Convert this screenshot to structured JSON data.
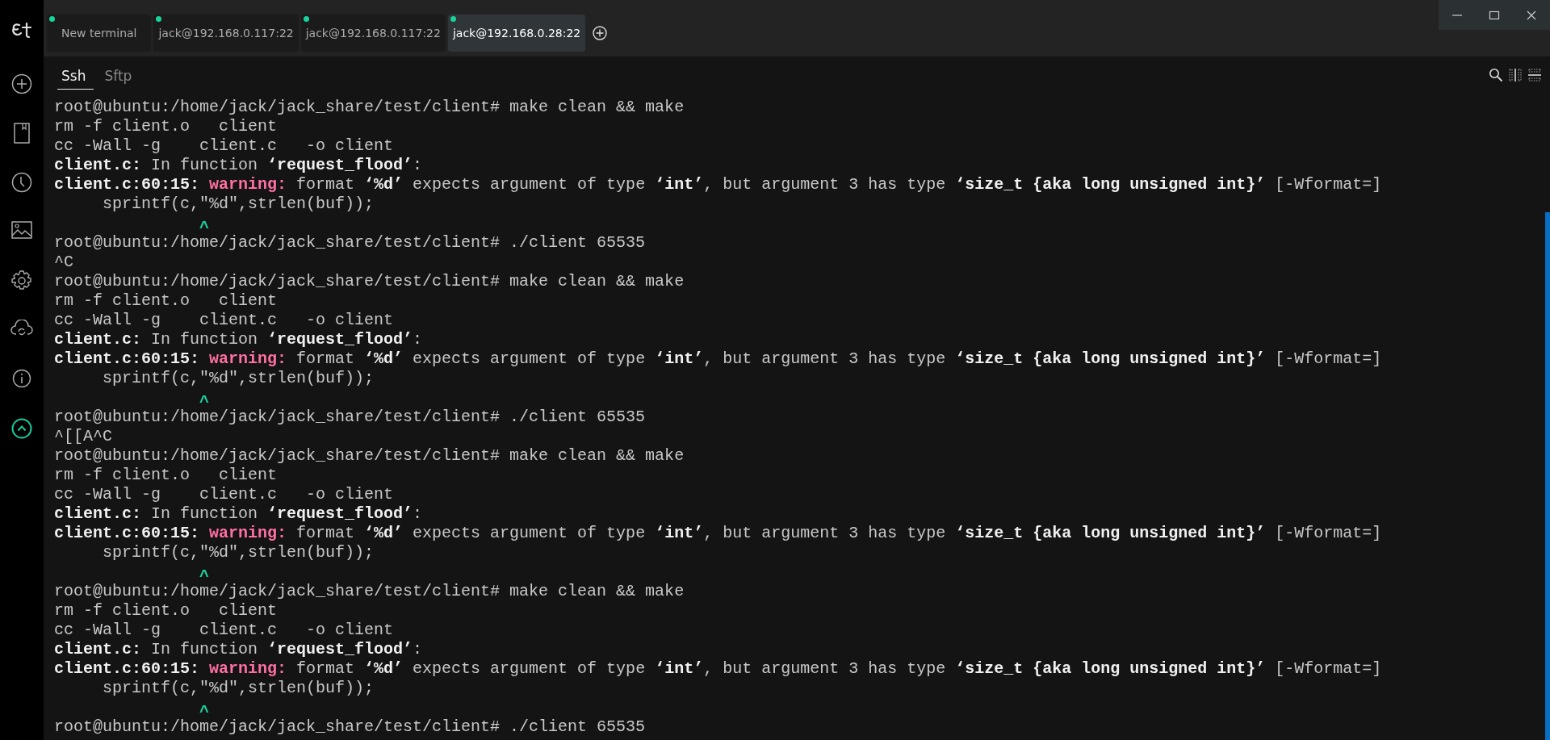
{
  "tabs": [
    {
      "label": "New terminal",
      "online": true,
      "selected": false
    },
    {
      "label": "jack@192.168.0.117:22",
      "online": true,
      "selected": false
    },
    {
      "label": "jack@192.168.0.117:22",
      "online": true,
      "selected": false
    },
    {
      "label": "jack@192.168.0.28:22",
      "online": true,
      "selected": true
    }
  ],
  "subtabs": [
    {
      "label": "Ssh",
      "selected": true
    },
    {
      "label": "Sftp",
      "selected": false
    }
  ],
  "terminal": {
    "lines": [
      [
        {
          "t": "root@ubuntu:/home/jack/jack_share/test/client# make clean && make",
          "kind": "plain"
        }
      ],
      [
        {
          "t": "rm -f client.o   client",
          "kind": "plain"
        }
      ],
      [
        {
          "t": "cc -Wall -g    client.c   -o client",
          "kind": "plain"
        }
      ],
      [
        {
          "t": "client.c:",
          "kind": "bold"
        },
        {
          "t": " In function ",
          "kind": "plain"
        },
        {
          "t": "‘request_flood’",
          "kind": "bold"
        },
        {
          "t": ":",
          "kind": "plain"
        }
      ],
      [
        {
          "t": "client.c:60:15: ",
          "kind": "bold"
        },
        {
          "t": "warning:",
          "kind": "warn"
        },
        {
          "t": " format ",
          "kind": "plain"
        },
        {
          "t": "‘%d’",
          "kind": "bold"
        },
        {
          "t": " expects argument of type ",
          "kind": "plain"
        },
        {
          "t": "‘int’",
          "kind": "bold"
        },
        {
          "t": ", but argument 3 has type ",
          "kind": "plain"
        },
        {
          "t": "‘size_t {aka long unsigned int}’",
          "kind": "bold"
        },
        {
          "t": " [-Wformat=]",
          "kind": "plain"
        }
      ],
      [
        {
          "t": "     sprintf(c,\"%d\",strlen(buf));",
          "kind": "plain"
        }
      ],
      [
        {
          "t": "               ^",
          "kind": "caret"
        }
      ],
      [
        {
          "t": "root@ubuntu:/home/jack/jack_share/test/client# ./client 65535",
          "kind": "plain"
        }
      ],
      [
        {
          "t": "^C",
          "kind": "plain"
        }
      ],
      [
        {
          "t": "root@ubuntu:/home/jack/jack_share/test/client# make clean && make",
          "kind": "plain"
        }
      ],
      [
        {
          "t": "rm -f client.o   client",
          "kind": "plain"
        }
      ],
      [
        {
          "t": "cc -Wall -g    client.c   -o client",
          "kind": "plain"
        }
      ],
      [
        {
          "t": "client.c:",
          "kind": "bold"
        },
        {
          "t": " In function ",
          "kind": "plain"
        },
        {
          "t": "‘request_flood’",
          "kind": "bold"
        },
        {
          "t": ":",
          "kind": "plain"
        }
      ],
      [
        {
          "t": "client.c:60:15: ",
          "kind": "bold"
        },
        {
          "t": "warning:",
          "kind": "warn"
        },
        {
          "t": " format ",
          "kind": "plain"
        },
        {
          "t": "‘%d’",
          "kind": "bold"
        },
        {
          "t": " expects argument of type ",
          "kind": "plain"
        },
        {
          "t": "‘int’",
          "kind": "bold"
        },
        {
          "t": ", but argument 3 has type ",
          "kind": "plain"
        },
        {
          "t": "‘size_t {aka long unsigned int}’",
          "kind": "bold"
        },
        {
          "t": " [-Wformat=]",
          "kind": "plain"
        }
      ],
      [
        {
          "t": "     sprintf(c,\"%d\",strlen(buf));",
          "kind": "plain"
        }
      ],
      [
        {
          "t": "               ^",
          "kind": "caret"
        }
      ],
      [
        {
          "t": "root@ubuntu:/home/jack/jack_share/test/client# ./client 65535",
          "kind": "plain"
        }
      ],
      [
        {
          "t": "^[[A^C",
          "kind": "plain"
        }
      ],
      [
        {
          "t": "root@ubuntu:/home/jack/jack_share/test/client# make clean && make",
          "kind": "plain"
        }
      ],
      [
        {
          "t": "rm -f client.o   client",
          "kind": "plain"
        }
      ],
      [
        {
          "t": "cc -Wall -g    client.c   -o client",
          "kind": "plain"
        }
      ],
      [
        {
          "t": "client.c:",
          "kind": "bold"
        },
        {
          "t": " In function ",
          "kind": "plain"
        },
        {
          "t": "‘request_flood’",
          "kind": "bold"
        },
        {
          "t": ":",
          "kind": "plain"
        }
      ],
      [
        {
          "t": "client.c:60:15: ",
          "kind": "bold"
        },
        {
          "t": "warning:",
          "kind": "warn"
        },
        {
          "t": " format ",
          "kind": "plain"
        },
        {
          "t": "‘%d’",
          "kind": "bold"
        },
        {
          "t": " expects argument of type ",
          "kind": "plain"
        },
        {
          "t": "‘int’",
          "kind": "bold"
        },
        {
          "t": ", but argument 3 has type ",
          "kind": "plain"
        },
        {
          "t": "‘size_t {aka long unsigned int}’",
          "kind": "bold"
        },
        {
          "t": " [-Wformat=]",
          "kind": "plain"
        }
      ],
      [
        {
          "t": "     sprintf(c,\"%d\",strlen(buf));",
          "kind": "plain"
        }
      ],
      [
        {
          "t": "               ^",
          "kind": "caret"
        }
      ],
      [
        {
          "t": "root@ubuntu:/home/jack/jack_share/test/client# make clean && make",
          "kind": "plain"
        }
      ],
      [
        {
          "t": "rm -f client.o   client",
          "kind": "plain"
        }
      ],
      [
        {
          "t": "cc -Wall -g    client.c   -o client",
          "kind": "plain"
        }
      ],
      [
        {
          "t": "client.c:",
          "kind": "bold"
        },
        {
          "t": " In function ",
          "kind": "plain"
        },
        {
          "t": "‘request_flood’",
          "kind": "bold"
        },
        {
          "t": ":",
          "kind": "plain"
        }
      ],
      [
        {
          "t": "client.c:60:15: ",
          "kind": "bold"
        },
        {
          "t": "warning:",
          "kind": "warn"
        },
        {
          "t": " format ",
          "kind": "plain"
        },
        {
          "t": "‘%d’",
          "kind": "bold"
        },
        {
          "t": " expects argument of type ",
          "kind": "plain"
        },
        {
          "t": "‘int’",
          "kind": "bold"
        },
        {
          "t": ", but argument 3 has type ",
          "kind": "plain"
        },
        {
          "t": "‘size_t {aka long unsigned int}’",
          "kind": "bold"
        },
        {
          "t": " [-Wformat=]",
          "kind": "plain"
        }
      ],
      [
        {
          "t": "     sprintf(c,\"%d\",strlen(buf));",
          "kind": "plain"
        }
      ],
      [
        {
          "t": "               ^",
          "kind": "caret"
        }
      ],
      [
        {
          "t": "root@ubuntu:/home/jack/jack_share/test/client# ./client 65535",
          "kind": "plain"
        }
      ]
    ]
  }
}
